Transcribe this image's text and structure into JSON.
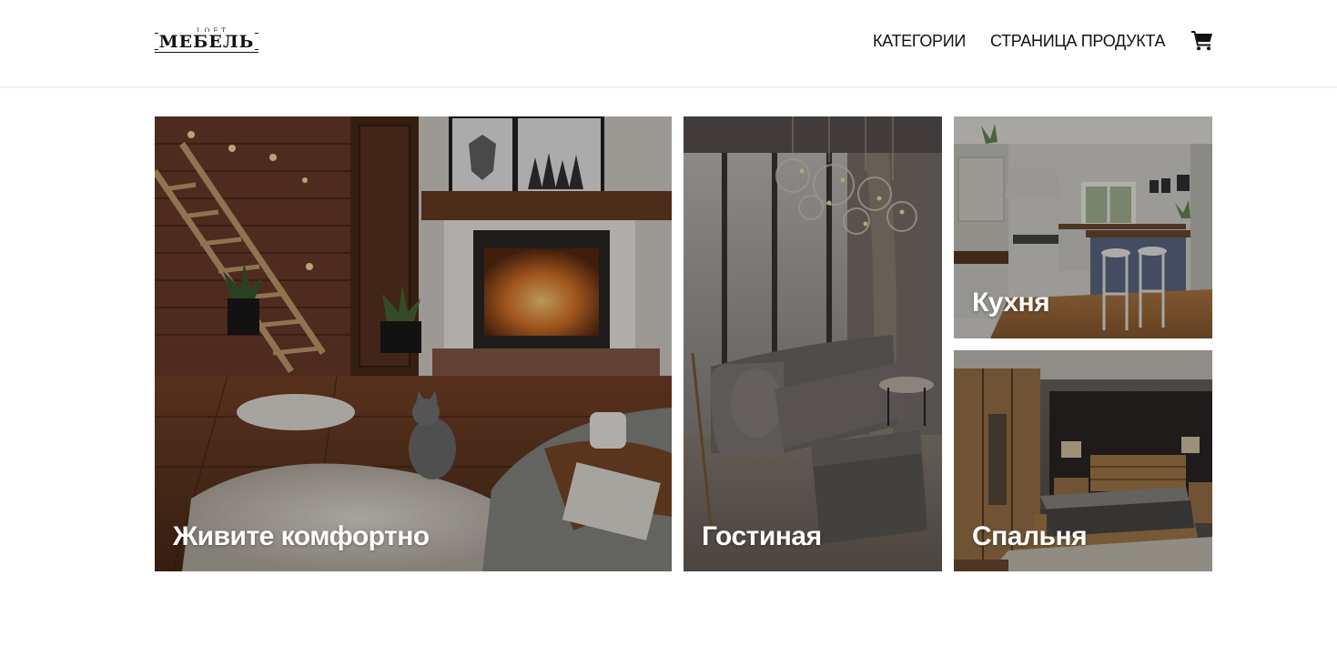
{
  "header": {
    "logo": {
      "small_text": "LOFT",
      "main_text": "МЕБЕЛЬ"
    },
    "nav": [
      {
        "label": "КАТЕГОРИИ"
      },
      {
        "label": "СТРАНИЦА ПРОДУКТА"
      }
    ],
    "cart_icon": "shopping-cart-icon"
  },
  "tiles": [
    {
      "label": "Живите комфортно",
      "image": "living-room-fireplace-cat"
    },
    {
      "label": "Гостиная",
      "image": "living-room-gray-sofa"
    },
    {
      "label": "Кухня",
      "image": "kitchen-island-stools"
    },
    {
      "label": "Спальня",
      "image": "bedroom-wooden-bed"
    }
  ],
  "colors": {
    "header_bg": "#ffffff",
    "nav_text": "#111111",
    "tile_label": "#ffffff"
  }
}
